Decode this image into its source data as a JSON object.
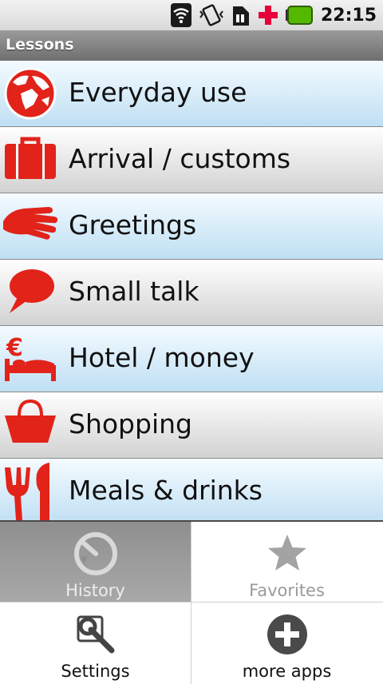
{
  "status_bar": {
    "time": "22:15",
    "icons": [
      "wifi-icon",
      "vibrate-icon",
      "sim-icon",
      "medical-cross-icon",
      "battery-icon"
    ],
    "colors": {
      "battery": "#55b800",
      "cross": "#e8003a"
    }
  },
  "header": {
    "title": "Lessons"
  },
  "lessons": [
    {
      "label": "Everyday use",
      "icon": "globe-icon"
    },
    {
      "label": "Arrival / customs",
      "icon": "suitcase-icon"
    },
    {
      "label": "Greetings",
      "icon": "hand-icon"
    },
    {
      "label": "Small talk",
      "icon": "speech-bubble-icon"
    },
    {
      "label": "Hotel / money",
      "icon": "hotel-euro-icon"
    },
    {
      "label": "Shopping",
      "icon": "shopping-basket-icon"
    },
    {
      "label": "Meals & drinks",
      "icon": "fork-knife-icon"
    }
  ],
  "menu": {
    "history": "History",
    "favorites": "Favorites",
    "settings": "Settings",
    "more_apps": "more apps"
  },
  "colors": {
    "accent_red": "#e2231a",
    "row_blue": "#bfdff3"
  }
}
